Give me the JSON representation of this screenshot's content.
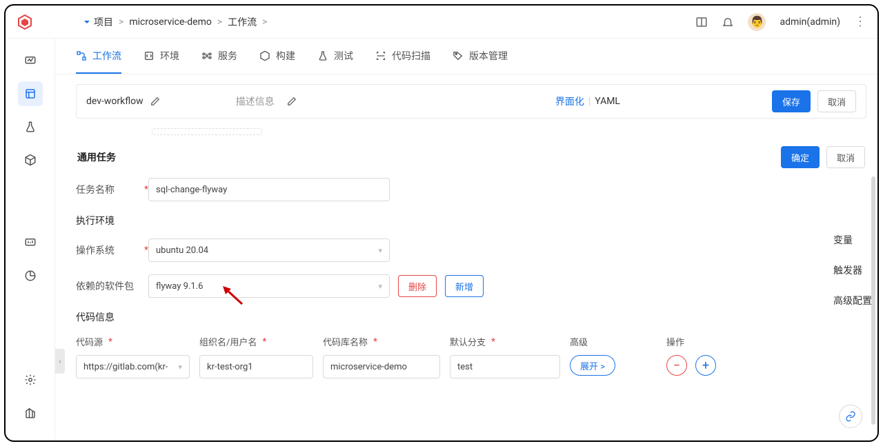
{
  "header": {
    "breadcrumb": {
      "root": "项目",
      "project": "microservice-demo",
      "section": "工作流"
    },
    "username": "admin(admin)"
  },
  "tabs": [
    {
      "label": "工作流",
      "active": true
    },
    {
      "label": "环境"
    },
    {
      "label": "服务"
    },
    {
      "label": "构建"
    },
    {
      "label": "测试"
    },
    {
      "label": "代码扫描"
    },
    {
      "label": "版本管理"
    }
  ],
  "wfbar": {
    "name": "dev-workflow",
    "desc": "描述信息",
    "mode_a": "界面化",
    "mode_b": "YAML",
    "save": "保存",
    "cancel": "取消"
  },
  "panel": {
    "title": "通用任务",
    "ok": "确定",
    "cancel": "取消"
  },
  "form": {
    "task_name_label": "任务名称",
    "task_name_value": "sql-change-flyway",
    "exec_env_title": "执行环境",
    "os_label": "操作系统",
    "os_value": "ubuntu 20.04",
    "dep_label": "依赖的软件包",
    "dep_value": "flyway 9.1.6",
    "delete": "删除",
    "add": "新增",
    "code_info_title": "代码信息",
    "cols": {
      "source": "代码源",
      "org": "组织名/用户名",
      "repo": "代码库名称",
      "branch": "默认分支",
      "advanced": "高级",
      "actions": "操作"
    },
    "vals": {
      "source": "https://gitlab.com(kr-",
      "org": "kr-test-org1",
      "repo": "microservice-demo",
      "branch": "test",
      "expand": "展开 >"
    }
  },
  "rail": {
    "vars": "变量",
    "triggers": "触发器",
    "adv": "高级配置"
  }
}
